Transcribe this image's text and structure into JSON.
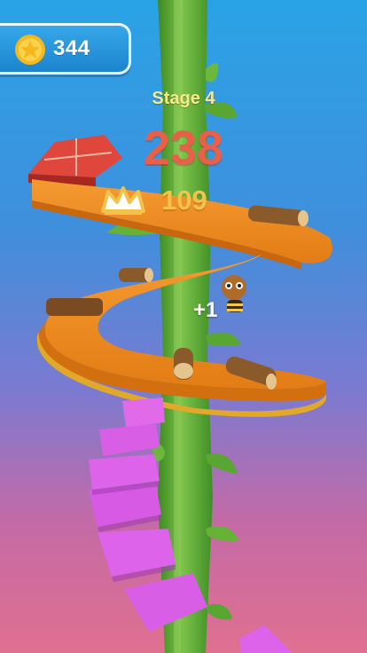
{
  "hud": {
    "coins": "344",
    "stage": "Stage 4",
    "score": "238",
    "best": "109",
    "bonus_popup": "+1"
  },
  "icons": {
    "coin": "star-coin-icon",
    "best": "crown-icon"
  },
  "colors": {
    "score": "#e8604a",
    "best": "#f2c24a",
    "stage": "#f7e98a",
    "platform_orange": "#f08a1e",
    "platform_magenta": "#d95ee6",
    "beanstalk": "#6ab23a"
  }
}
